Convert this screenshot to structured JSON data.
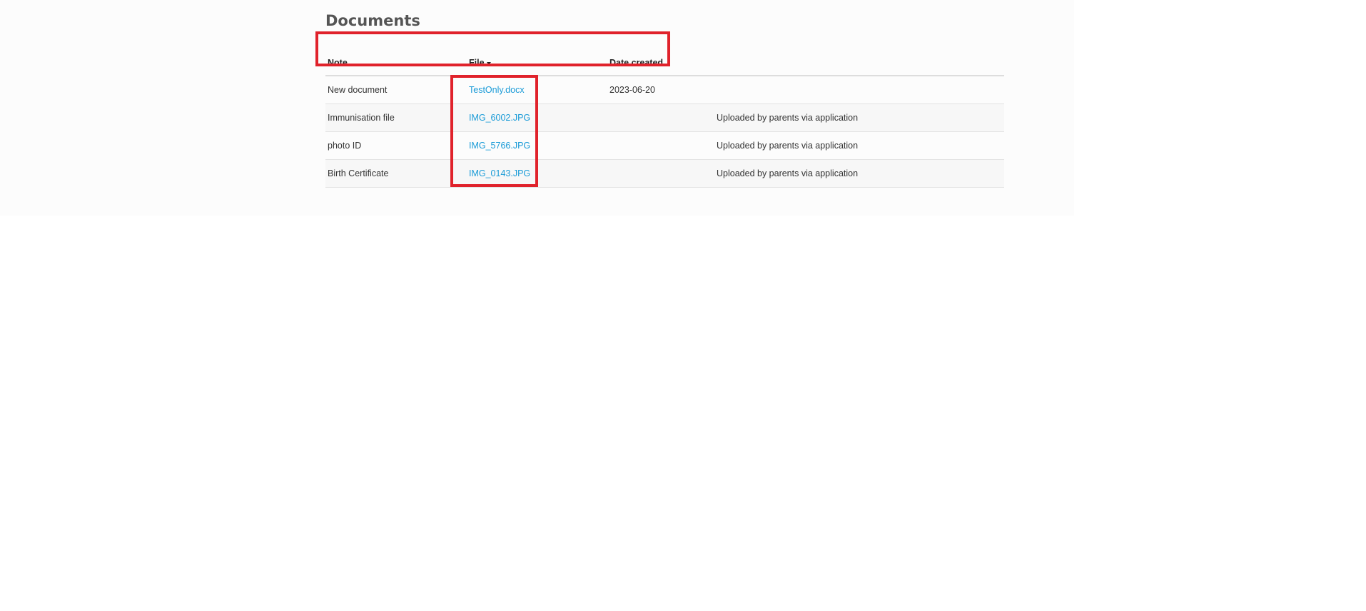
{
  "page": {
    "title": "Documents"
  },
  "table": {
    "headers": {
      "note": "Note",
      "file": "File",
      "date_created": "Date created",
      "extra": ""
    },
    "rows": [
      {
        "note": "New document",
        "file": "TestOnly.docx",
        "date_created": "2023-06-20",
        "extra": ""
      },
      {
        "note": "Immunisation file",
        "file": "IMG_6002.JPG",
        "date_created": "",
        "extra": "Uploaded by parents via application"
      },
      {
        "note": "photo ID",
        "file": "IMG_5766.JPG",
        "date_created": "",
        "extra": "Uploaded by parents via application"
      },
      {
        "note": "Birth Certificate",
        "file": "IMG_0143.JPG",
        "date_created": "",
        "extra": "Uploaded by parents via application"
      }
    ]
  },
  "annotations": {
    "highlight_color": "#e0222b"
  },
  "colors": {
    "link": "#1a9bd7",
    "title": "#555555"
  }
}
